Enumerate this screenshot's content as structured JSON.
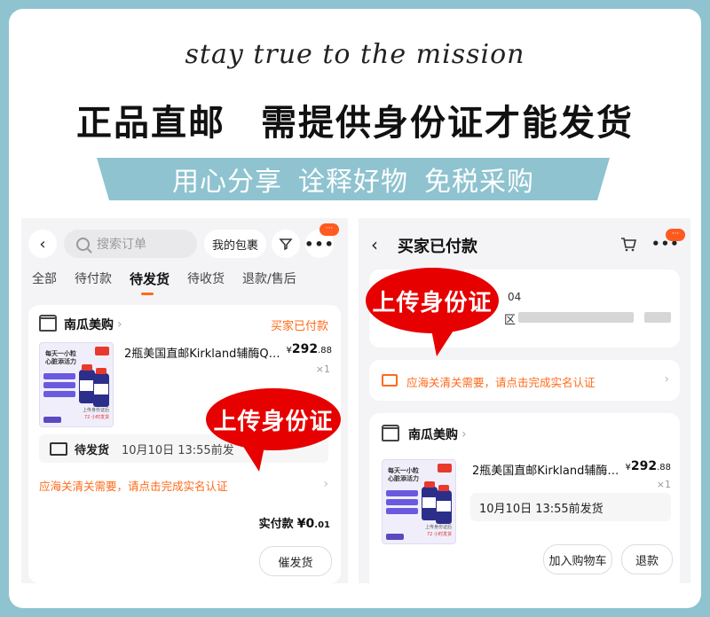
{
  "header": {
    "slogan": "stay true to the mission",
    "headline_left": "正品直邮",
    "headline_right": "需提供身份证才能发货",
    "banner": [
      "用心分享",
      "诠释好物",
      "免税采购"
    ]
  },
  "left_screen": {
    "search_placeholder": "搜索订单",
    "my_packages": "我的包裹",
    "filter_icon": "filter-icon",
    "more_badge": "···",
    "tabs": [
      "全部",
      "待付款",
      "待发货",
      "待收货",
      "退款/售后"
    ],
    "active_tab": "待发货",
    "shop_name": "南瓜美购",
    "order_status": "买家已付款",
    "product_title": "2瓶美国直邮Kirkland辅酶Q…",
    "price_symbol": "¥",
    "price_int": "292",
    "price_dec": ".88",
    "quantity": "×1",
    "ship_label": "待发货",
    "ship_time": "10月10日 13:55前发",
    "customs_notice": "应海关清关需要，请点击完成实名认证",
    "paid_label": "实付款",
    "paid_int": "¥0",
    "paid_dec": ".01",
    "urge_button": "催发货",
    "callout": "上传身份证"
  },
  "right_screen": {
    "title": "买家已付款",
    "cart_icon": "cart-icon",
    "more_badge": "···",
    "address_fragment": "04",
    "address_prefix": "区",
    "customs_notice": "应海关清关需要，请点击完成实名认证",
    "shop_name": "南瓜美购",
    "product_title": "2瓶美国直邮Kirkland辅酶…",
    "price_symbol": "¥",
    "price_int": "292",
    "price_dec": ".88",
    "quantity": "×1",
    "ship_time": "10月10日 13:55前发货",
    "add_cart_button": "加入购物车",
    "refund_button": "退款",
    "callout": "上传身份证"
  },
  "product_image": {
    "title": "每天一小粒 心脏添活力",
    "label": "CoQ10",
    "footer": "上传身份证后",
    "hours": "72 小时发货"
  },
  "colors": {
    "frame": "#8ec3cf",
    "accent": "#ff6a1a",
    "callout": "#e60000"
  }
}
